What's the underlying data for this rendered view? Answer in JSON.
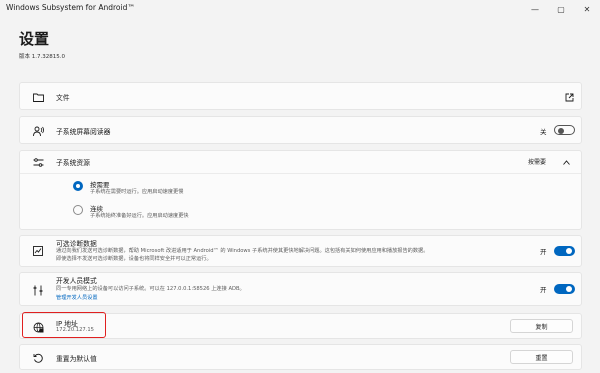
{
  "window": {
    "title": "Windows Subsystem for Android™",
    "controls": {
      "minimize": "—",
      "maximize": "▢",
      "close": "✕"
    }
  },
  "header": {
    "title": "设置",
    "version": "版本 1.7.32815.0"
  },
  "rows": {
    "files": {
      "title": "文件",
      "icon": "folder-icon",
      "action_icon": "open-external-icon"
    },
    "screen_reader": {
      "title": "子系统屏幕阅读器",
      "toggle_label": "关",
      "toggle_on": false,
      "icon": "accessibility-icon"
    },
    "resources": {
      "title": "子系统资源",
      "selected_value": "按需要",
      "icon": "sliders-icon",
      "options": [
        {
          "title": "按需要",
          "desc": "子系统在需要时运行。应用启动速度更慢",
          "selected": true
        },
        {
          "title": "连续",
          "desc": "子系统始终准备好运行。应用启动速度更快",
          "selected": false
        }
      ]
    },
    "diagnostics": {
      "title": "可选诊断数据",
      "desc1": "通过向我们发送可选诊断数据，帮助 Microsoft 改进适用于 Android™ 的 Windows 子系统并使其更快地解决问题。这包括有关如何使用应用和播放报告的数据。",
      "desc2": "即使选择不发送可选诊断数据，设备也将同样安全并可以正常运行。",
      "toggle_label": "开",
      "toggle_on": true,
      "icon": "chart-icon"
    },
    "developer": {
      "title": "开发人员模式",
      "desc": "同一专用网络上的设备可以访问子系统。可以在 127.0.0.1:58526 上连接 ADB。",
      "link": "管理开发人员设置",
      "toggle_label": "开",
      "toggle_on": true,
      "icon": "developer-icon"
    },
    "ip": {
      "title": "IP 地址",
      "value": "172.20.127.15",
      "button": "复制",
      "icon": "network-icon"
    },
    "reset": {
      "title": "重置为默认值",
      "button": "重置",
      "icon": "reset-icon"
    }
  },
  "colors": {
    "accent": "#0067c0",
    "highlight": "#e02020",
    "background": "#f3f3f3"
  }
}
